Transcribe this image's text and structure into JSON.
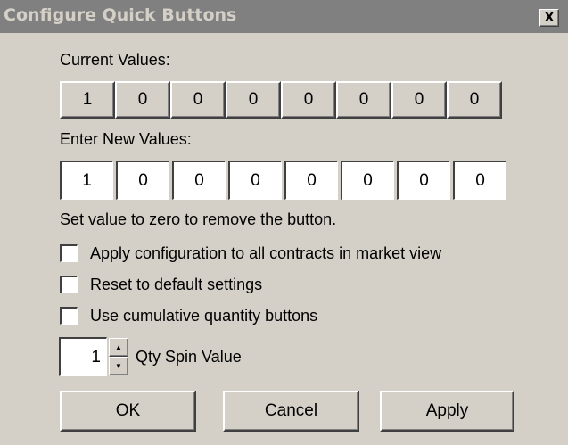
{
  "window": {
    "title": "Configure Quick Buttons",
    "close_glyph": "X"
  },
  "current": {
    "label": "Current Values:",
    "values": [
      "1",
      "0",
      "0",
      "0",
      "0",
      "0",
      "0",
      "0"
    ]
  },
  "new_values": {
    "label": "Enter New Values:",
    "values": [
      "1",
      "0",
      "0",
      "0",
      "0",
      "0",
      "0",
      "0"
    ]
  },
  "hint": "Set value to zero to remove the button.",
  "options": [
    {
      "label": "Apply configuration to all contracts in market view",
      "checked": false
    },
    {
      "label": "Reset to default settings",
      "checked": false
    },
    {
      "label": "Use cumulative quantity buttons",
      "checked": false
    }
  ],
  "spin": {
    "value": "1",
    "label": "Qty Spin Value",
    "up_glyph": "▲",
    "down_glyph": "▼"
  },
  "buttons": {
    "ok": "OK",
    "cancel": "Cancel",
    "apply": "Apply"
  }
}
